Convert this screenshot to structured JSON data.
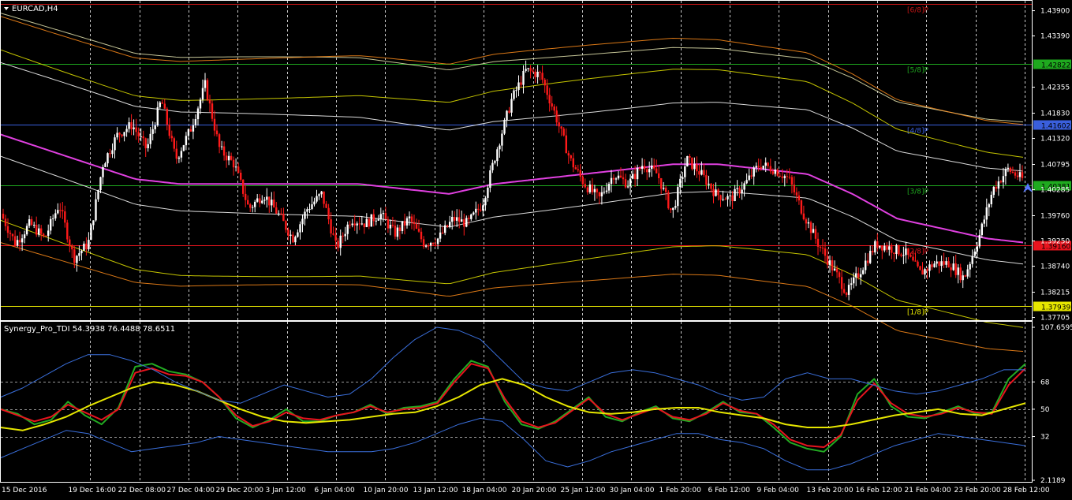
{
  "chart_window": {
    "symbol_title": "EURCAD,H4",
    "indicator_title": "Synergy_Pro_TDI 54.3938 76.4488 78.6511"
  },
  "chart_data": [
    {
      "type": "candlestick",
      "title": "EURCAD,H4",
      "ylim": [
        1.3765,
        1.441
      ],
      "price_ticks": [
        "1.43900",
        "1.43390",
        "1.42355",
        "1.41830",
        "1.41320",
        "1.40795",
        "1.40285",
        "1.39760",
        "1.39250",
        "1.38740",
        "1.38215",
        "1.37705"
      ],
      "grid": "dashed-vertical",
      "murrey_lines": [
        {
          "label": "[5/8]P",
          "value": 1.42822,
          "value_label": "1.42822",
          "color": "#1faa1f"
        },
        {
          "label": "[4/8]P",
          "value": 1.41602,
          "value_label": "1.41602",
          "color": "#3a5fdc"
        },
        {
          "label": "[3/8]P",
          "value": 1.40381,
          "value_label": "1.40381",
          "color": "#1faa1f"
        },
        {
          "label": "[2/8]P",
          "value": 1.3916,
          "value_label": "1.39160",
          "color": "#e8141e"
        },
        {
          "label": "[1/8]P",
          "value": 1.37939,
          "value_label": "1.37939",
          "color": "#e6e600"
        },
        {
          "label": "[6/8]P",
          "value": 1.4404,
          "value_label": "",
          "color": "#c81414"
        }
      ],
      "close_path": [
        1.398,
        1.392,
        1.396,
        1.393,
        1.4,
        1.389,
        1.392,
        1.408,
        1.414,
        1.416,
        1.411,
        1.421,
        1.409,
        1.415,
        1.424,
        1.411,
        1.408,
        1.399,
        1.402,
        1.398,
        1.393,
        1.399,
        1.402,
        1.391,
        1.397,
        1.396,
        1.398,
        1.394,
        1.397,
        1.392,
        1.393,
        1.397,
        1.396,
        1.4,
        1.411,
        1.421,
        1.427,
        1.426,
        1.418,
        1.409,
        1.404,
        1.401,
        1.406,
        1.404,
        1.408,
        1.406,
        1.398,
        1.409,
        1.406,
        1.402,
        1.401,
        1.404,
        1.408,
        1.407,
        1.405,
        1.398,
        1.392,
        1.387,
        1.382,
        1.387,
        1.392,
        1.391,
        1.39,
        1.386,
        1.388,
        1.388,
        1.385,
        1.393,
        1.403,
        1.407,
        1.405
      ],
      "moving_average": {
        "color": "#e040e0",
        "values": [
          1.414,
          1.411,
          1.408,
          1.405,
          1.404,
          1.404,
          1.404,
          1.404,
          1.404,
          1.403,
          1.402,
          1.404,
          1.405,
          1.406,
          1.407,
          1.408,
          1.408,
          1.407,
          1.406,
          1.402,
          1.397,
          1.395,
          1.393,
          1.392
        ]
      },
      "x_ticks": [
        "15 Dec 2016",
        "19 Dec 16:00",
        "22 Dec 08:00",
        "27 Dec 04:00",
        "29 Dec 20:00",
        "3 Jan 12:00",
        "6 Jan 04:00",
        "10 Jan 20:00",
        "13 Jan 12:00",
        "18 Jan 04:00",
        "20 Jan 20:00",
        "25 Jan 12:00",
        "30 Jan 04:00",
        "1 Feb 20:00",
        "6 Feb 12:00",
        "9 Feb 04:00",
        "13 Feb 20:00",
        "16 Feb 12:00",
        "21 Feb 04:00",
        "23 Feb 20:00",
        "28 Feb 12:00"
      ]
    },
    {
      "type": "line",
      "title": "Synergy_Pro_TDI 54.3938 76.4488 78.6511",
      "ylim": [
        2.1189,
        107.6595
      ],
      "y_ticks": [
        "107.6595",
        "68",
        "50",
        "32",
        "2.1189"
      ],
      "levels": [
        68,
        50,
        32
      ],
      "series": [
        {
          "color": "#22aa22",
          "values": [
            50,
            47,
            40,
            43,
            55,
            46,
            40,
            51,
            78,
            80,
            75,
            73,
            68,
            58,
            44,
            38,
            43,
            50,
            42,
            42,
            46,
            48,
            53,
            47,
            51,
            52,
            55,
            70,
            82,
            78,
            55,
            40,
            37,
            42,
            50,
            58,
            45,
            42,
            48,
            52,
            44,
            42,
            48,
            55,
            48,
            47,
            38,
            28,
            24,
            22,
            32,
            60,
            70,
            52,
            45,
            44,
            48,
            52,
            47,
            48,
            70,
            80
          ]
        },
        {
          "color": "#e8141e",
          "values": [
            50,
            46,
            42,
            45,
            53,
            48,
            43,
            50,
            74,
            77,
            73,
            72,
            68,
            58,
            46,
            39,
            42,
            48,
            44,
            43,
            46,
            48,
            52,
            48,
            50,
            51,
            54,
            68,
            80,
            77,
            57,
            42,
            38,
            41,
            49,
            57,
            47,
            43,
            47,
            51,
            45,
            43,
            47,
            54,
            49,
            47,
            40,
            30,
            26,
            25,
            33,
            56,
            67,
            54,
            47,
            45,
            47,
            51,
            48,
            47,
            66,
            77
          ]
        },
        {
          "color": "#e6e600",
          "values": [
            38,
            36,
            40,
            45,
            52,
            58,
            64,
            68,
            66,
            62,
            56,
            50,
            45,
            42,
            41,
            42,
            43,
            45,
            47,
            48,
            52,
            58,
            66,
            70,
            66,
            58,
            52,
            48,
            47,
            48,
            50,
            51,
            51,
            48,
            46,
            44,
            40,
            38,
            38,
            40,
            43,
            46,
            48,
            50,
            47,
            46,
            50,
            54
          ]
        },
        {
          "color": "#3a6fdc",
          "values": [
            58,
            64,
            72,
            80,
            86,
            86,
            82,
            76,
            68,
            62,
            56,
            54,
            60,
            66,
            62,
            58,
            60,
            70,
            84,
            96,
            104,
            102,
            96,
            82,
            68,
            64,
            62,
            68,
            74,
            76,
            74,
            70,
            66,
            60,
            56,
            58,
            70,
            74,
            70,
            70,
            66,
            62,
            60,
            62,
            66,
            70,
            76,
            76
          ]
        },
        {
          "color": "#3a6fdc",
          "values": [
            18,
            24,
            30,
            36,
            34,
            28,
            22,
            24,
            26,
            28,
            32,
            30,
            28,
            26,
            24,
            22,
            22,
            22,
            24,
            28,
            34,
            40,
            44,
            42,
            30,
            16,
            12,
            16,
            22,
            26,
            30,
            34,
            34,
            30,
            28,
            24,
            16,
            10,
            10,
            14,
            20,
            26,
            30,
            34,
            32,
            30,
            28,
            26
          ]
        }
      ]
    }
  ]
}
